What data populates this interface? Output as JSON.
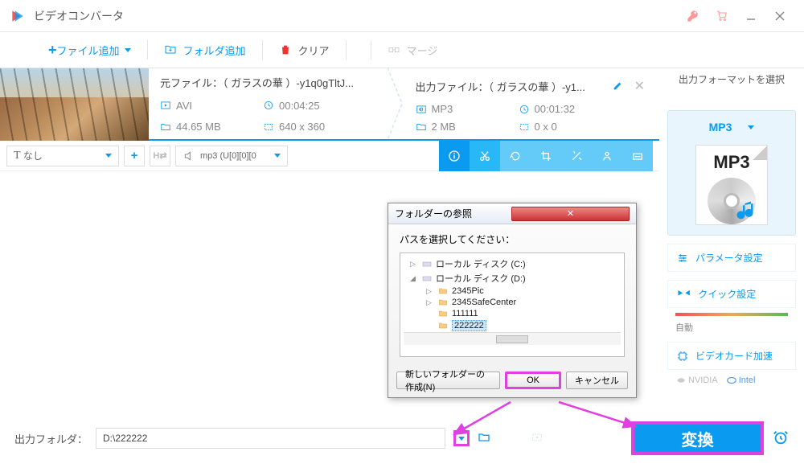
{
  "app": {
    "title": "ビデオコンバータ"
  },
  "toolbar": {
    "add_file": "ファイル追加",
    "add_folder": "フォルダ追加",
    "clear": "クリア",
    "merge": "マージ"
  },
  "item": {
    "source": {
      "title": "元ファイル：（ ガラスの華 ）-y1q0gTltJ...",
      "format": "AVI",
      "duration": "00:04:25",
      "size": "44.65 MB",
      "resolution": "640 x 360"
    },
    "output": {
      "title": "出力ファイル：（ ガラスの華 ）-y1...",
      "format": "MP3",
      "duration": "00:01:32",
      "size": "2 MB",
      "resolution": "0 x 0"
    },
    "subtitle_select": "なし",
    "audio_select": "mp3 (U[0][0][0"
  },
  "side": {
    "label": "出力フォーマットを選択",
    "format_name": "MP3",
    "format_badge": "MP3",
    "params": "パラメータ設定",
    "quick": "クイック設定",
    "slider_label": "自動",
    "gpu_accel": "ビデオカード加速",
    "nvidia": "NVIDIA",
    "intel": "Intel"
  },
  "bottom": {
    "label": "出力フォルダ：",
    "path": "D:\\222222",
    "convert": "変換"
  },
  "dialog": {
    "title": "フォルダーの参照",
    "prompt": "パスを選択してください：",
    "tree": {
      "c_drive": "ローカル ディスク (C:)",
      "d_drive": "ローカル ディスク (D:)",
      "f1": "2345Pic",
      "f2": "2345SafeCenter",
      "f3": "111111",
      "f4": "222222"
    },
    "new_folder": "新しいフォルダーの作成(N)",
    "ok": "OK",
    "cancel": "キャンセル"
  }
}
